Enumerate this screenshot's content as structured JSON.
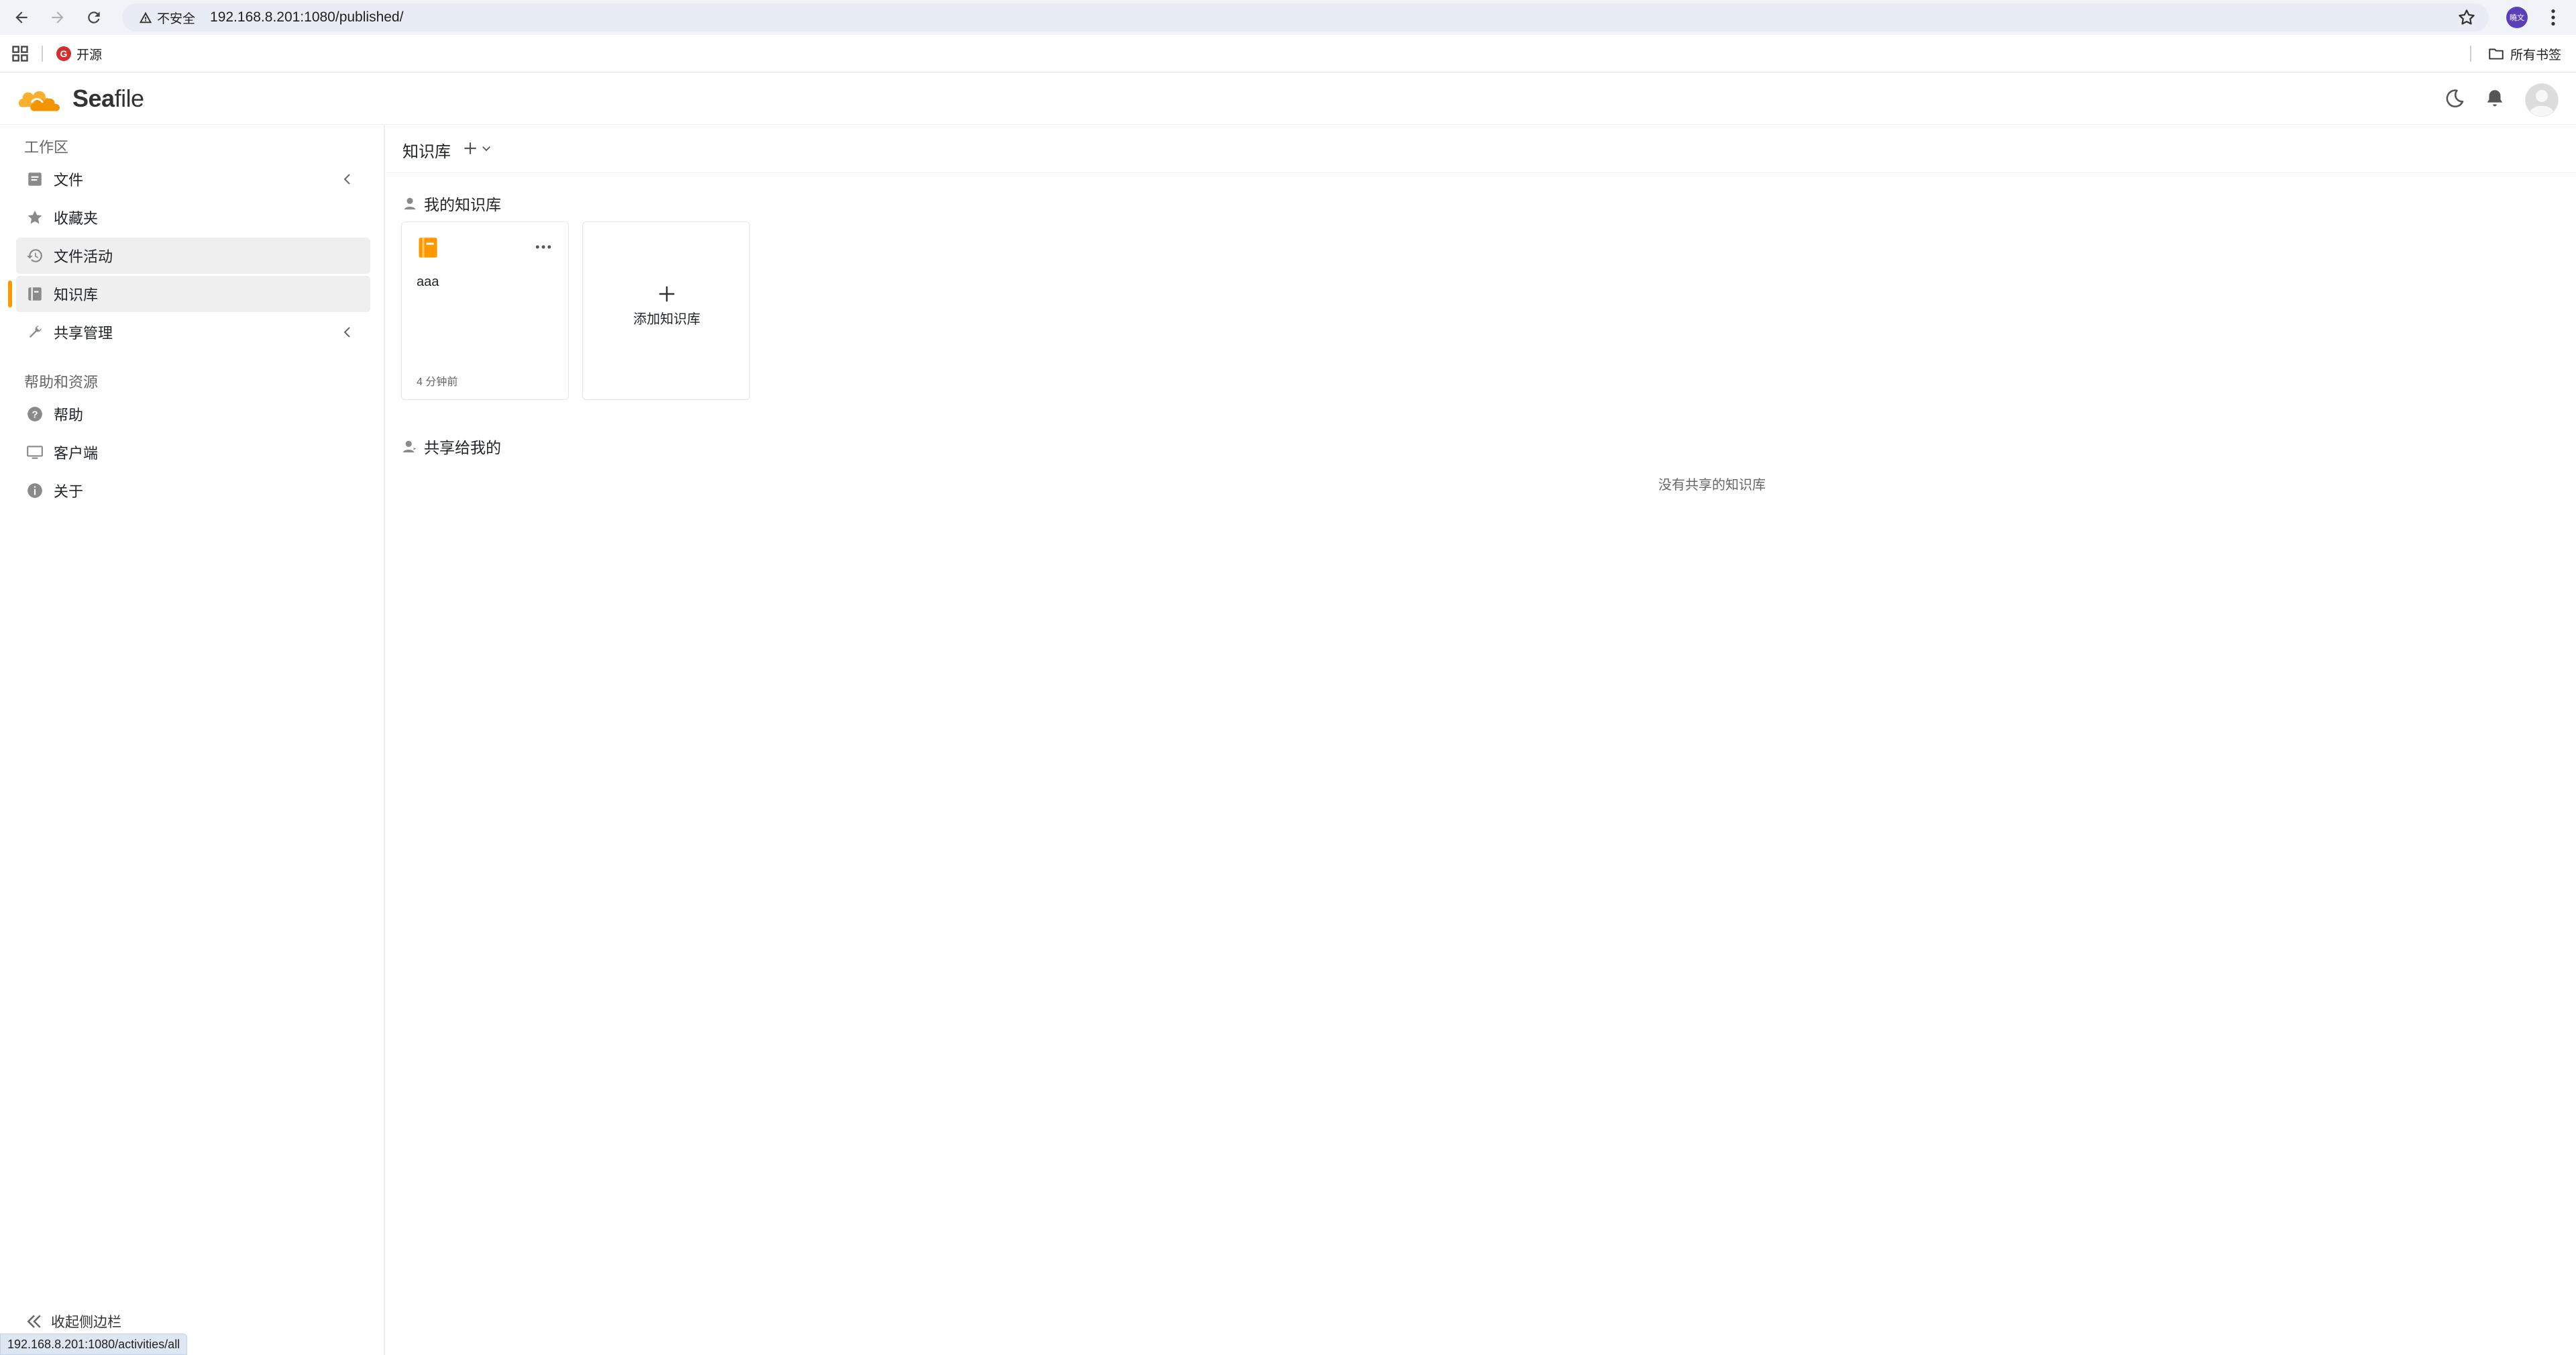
{
  "browser": {
    "security_label": "不安全",
    "url": "192.168.8.201:1080/published/",
    "profile_initials": "曉文",
    "bookmark_item": "开源",
    "bookmark_favicon": "G",
    "all_bookmarks": "所有书签",
    "status_url": "192.168.8.201:1080/activities/all"
  },
  "app": {
    "logo_text_bold": "Sea",
    "logo_text_rest": "file"
  },
  "sidebar": {
    "workspace_heading": "工作区",
    "items": [
      {
        "label": "文件",
        "icon": "file-icon"
      },
      {
        "label": "收藏夹",
        "icon": "star-icon"
      },
      {
        "label": "文件活动",
        "icon": "history-icon"
      },
      {
        "label": "知识库",
        "icon": "wiki-icon"
      },
      {
        "label": "共享管理",
        "icon": "wrench-icon"
      }
    ],
    "help_heading": "帮助和资源",
    "help_items": [
      {
        "label": "帮助",
        "icon": "help-icon"
      },
      {
        "label": "客户端",
        "icon": "monitor-icon"
      },
      {
        "label": "关于",
        "icon": "info-icon"
      }
    ],
    "collapse_label": "收起侧边栏"
  },
  "main": {
    "title": "知识库",
    "my_wikis_heading": "我的知识库",
    "wikis": [
      {
        "name": "aaa",
        "time": "4 分钟前"
      }
    ],
    "add_wiki_label": "添加知识库",
    "shared_heading": "共享给我的",
    "shared_empty": "没有共享的知识库"
  },
  "colors": {
    "accent": "#ff9800",
    "wiki_icon": "#ff9800",
    "selected_bg": "#efefef"
  }
}
